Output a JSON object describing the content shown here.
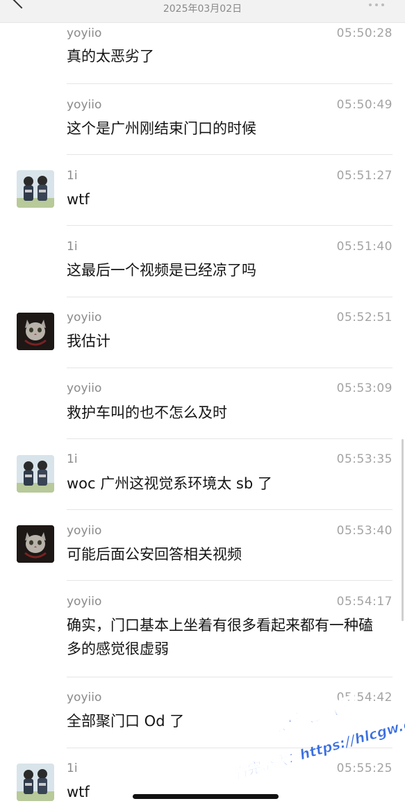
{
  "header": {
    "date": "2025年03月02日"
  },
  "messages": [
    {
      "name": "yoyiio",
      "time": "05:50:28",
      "text": "真的太恶劣了",
      "avatar": ""
    },
    {
      "name": "yoyiio",
      "time": "05:50:49",
      "text": "这个是广州刚结束门口的时候",
      "avatar": ""
    },
    {
      "name": "1i",
      "time": "05:51:27",
      "text": "wtf",
      "avatar": "pair"
    },
    {
      "name": "1i",
      "time": "05:51:40",
      "text": "这最后一个视频是已经凉了吗",
      "avatar": ""
    },
    {
      "name": "yoyiio",
      "time": "05:52:51",
      "text": "我估计",
      "avatar": "cat"
    },
    {
      "name": "yoyiio",
      "time": "05:53:09",
      "text": "救护车叫的也不怎么及时",
      "avatar": ""
    },
    {
      "name": "1i",
      "time": "05:53:35",
      "text": "woc 广州这视觉系环境太 sb 了",
      "avatar": "pair"
    },
    {
      "name": "yoyiio",
      "time": "05:53:40",
      "text": "可能后面公安回答相关视频",
      "avatar": "cat"
    },
    {
      "name": "yoyiio",
      "time": "05:54:17",
      "text": "确实，门口基本上坐着有很多看起来都有一种磕多的感觉很虚弱",
      "avatar": ""
    },
    {
      "name": "yoyiio",
      "time": "05:54:42",
      "text": "全部聚门口 Od 了",
      "avatar": ""
    },
    {
      "name": "1i",
      "time": "05:55:25",
      "text": "wtf",
      "avatar": "pair"
    }
  ],
  "watermark": {
    "line1": "黑料吃瓜网",
    "line2": "看完整版：https://hlcgw.co"
  }
}
